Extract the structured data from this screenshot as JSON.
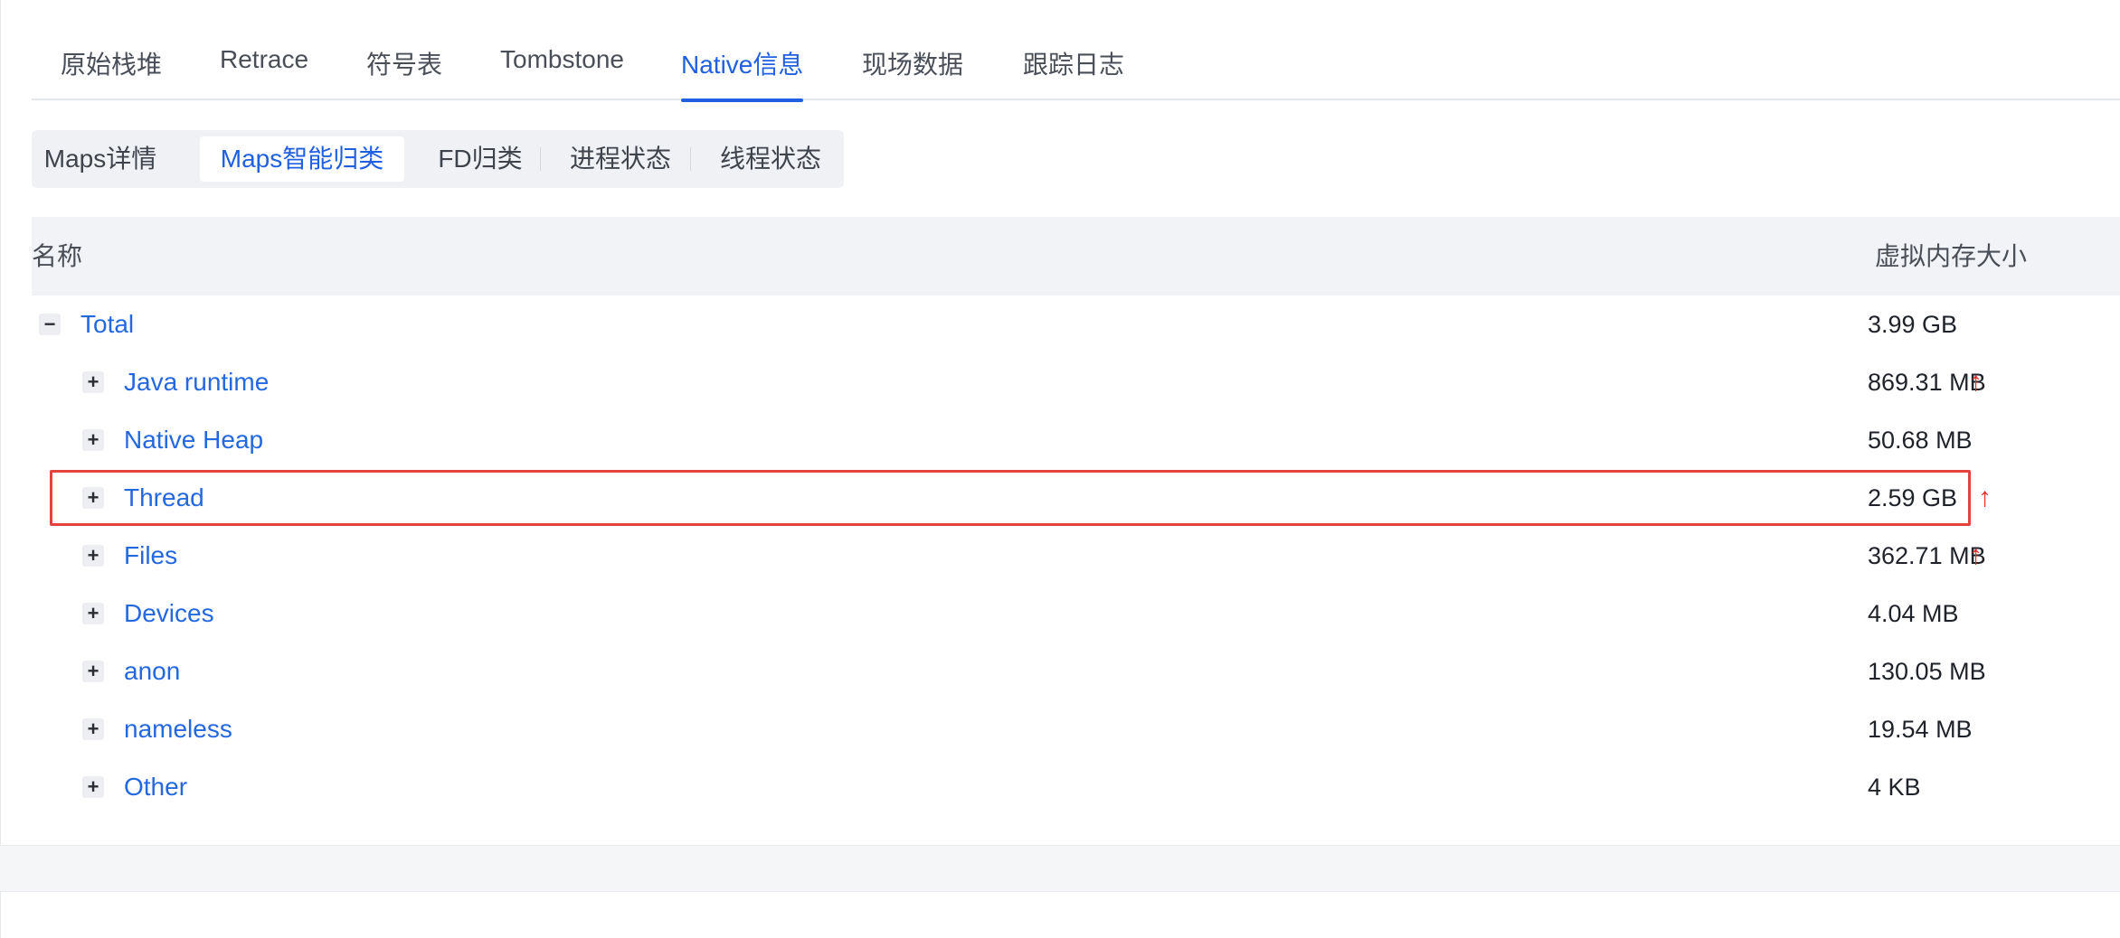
{
  "main_tabs": [
    {
      "label": "原始栈堆"
    },
    {
      "label": "Retrace"
    },
    {
      "label": "符号表"
    },
    {
      "label": "Tombstone"
    },
    {
      "label": "Native信息",
      "active": true
    },
    {
      "label": "现场数据"
    },
    {
      "label": "跟踪日志"
    }
  ],
  "sub_tabs": [
    {
      "label": "Maps详情"
    },
    {
      "label": "Maps智能归类",
      "active": true
    },
    {
      "label": "FD归类"
    },
    {
      "label": "进程状态"
    },
    {
      "label": "线程状态"
    }
  ],
  "table": {
    "columns": {
      "name": "名称",
      "size": "虚拟内存大小"
    },
    "root": {
      "name": "Total",
      "size": "3.99 GB",
      "toggle": "−"
    },
    "rows": [
      {
        "name": "Java runtime",
        "size": "869.31 MB",
        "arrow": "↑",
        "toggle": "+"
      },
      {
        "name": "Native Heap",
        "size": "50.68 MB",
        "toggle": "+"
      },
      {
        "name": "Thread",
        "size": "2.59 GB",
        "arrow": "↑",
        "toggle": "+"
      },
      {
        "name": "Files",
        "size": "362.71 MB",
        "arrow": "↑",
        "toggle": "+"
      },
      {
        "name": "Devices",
        "size": "4.04 MB",
        "toggle": "+"
      },
      {
        "name": "anon",
        "size": "130.05 MB",
        "toggle": "+"
      },
      {
        "name": "nameless",
        "size": "19.54 MB",
        "toggle": "+"
      },
      {
        "name": "Other",
        "size": "4 KB",
        "toggle": "+"
      }
    ]
  },
  "colors": {
    "accent": "#1f5fe0",
    "link": "#2468e0",
    "increase_arrow": "#e5302b",
    "highlight_border": "#e5423d"
  }
}
